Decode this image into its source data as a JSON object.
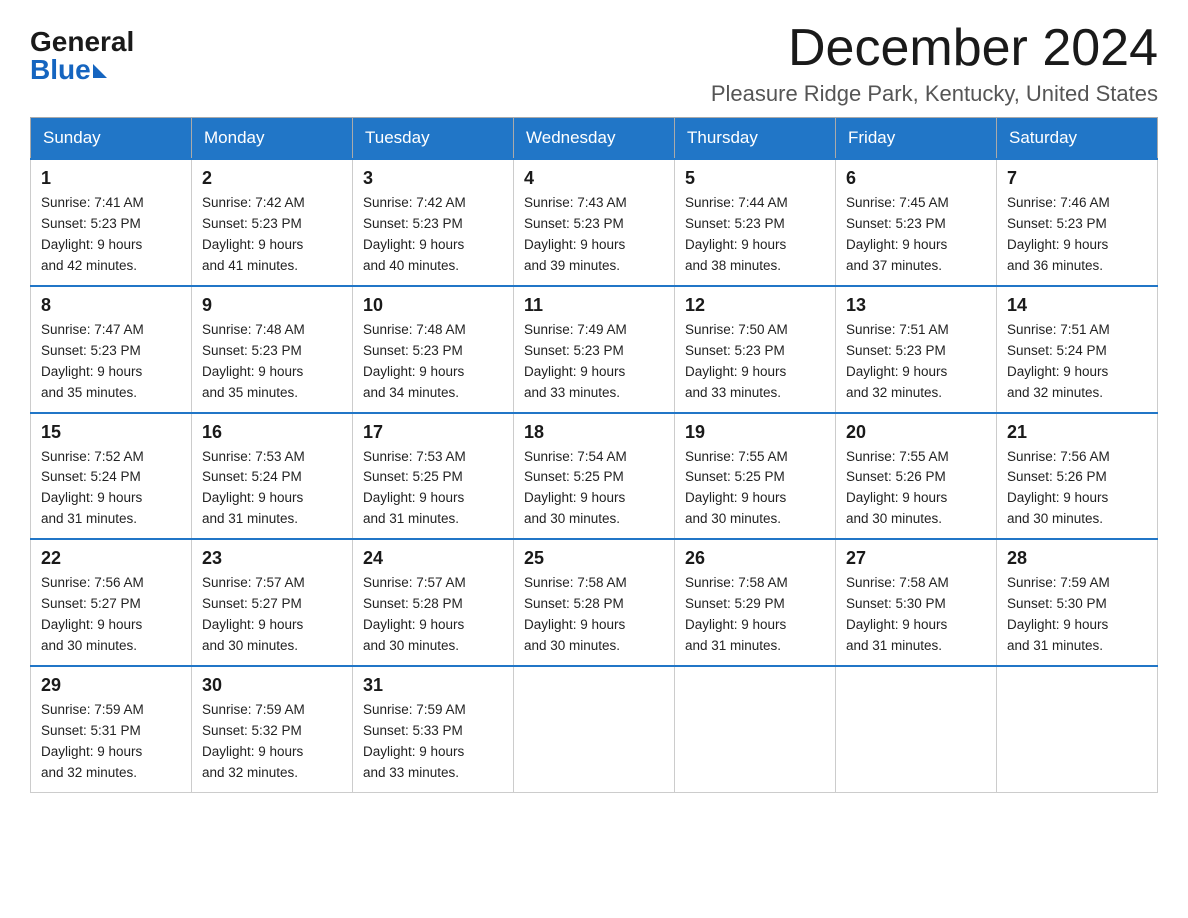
{
  "header": {
    "logo_general": "General",
    "logo_blue": "Blue",
    "month_title": "December 2024",
    "location": "Pleasure Ridge Park, Kentucky, United States"
  },
  "weekdays": [
    "Sunday",
    "Monday",
    "Tuesday",
    "Wednesday",
    "Thursday",
    "Friday",
    "Saturday"
  ],
  "weeks": [
    [
      {
        "day": "1",
        "sunrise": "7:41 AM",
        "sunset": "5:23 PM",
        "daylight": "9 hours and 42 minutes."
      },
      {
        "day": "2",
        "sunrise": "7:42 AM",
        "sunset": "5:23 PM",
        "daylight": "9 hours and 41 minutes."
      },
      {
        "day": "3",
        "sunrise": "7:42 AM",
        "sunset": "5:23 PM",
        "daylight": "9 hours and 40 minutes."
      },
      {
        "day": "4",
        "sunrise": "7:43 AM",
        "sunset": "5:23 PM",
        "daylight": "9 hours and 39 minutes."
      },
      {
        "day": "5",
        "sunrise": "7:44 AM",
        "sunset": "5:23 PM",
        "daylight": "9 hours and 38 minutes."
      },
      {
        "day": "6",
        "sunrise": "7:45 AM",
        "sunset": "5:23 PM",
        "daylight": "9 hours and 37 minutes."
      },
      {
        "day": "7",
        "sunrise": "7:46 AM",
        "sunset": "5:23 PM",
        "daylight": "9 hours and 36 minutes."
      }
    ],
    [
      {
        "day": "8",
        "sunrise": "7:47 AM",
        "sunset": "5:23 PM",
        "daylight": "9 hours and 35 minutes."
      },
      {
        "day": "9",
        "sunrise": "7:48 AM",
        "sunset": "5:23 PM",
        "daylight": "9 hours and 35 minutes."
      },
      {
        "day": "10",
        "sunrise": "7:48 AM",
        "sunset": "5:23 PM",
        "daylight": "9 hours and 34 minutes."
      },
      {
        "day": "11",
        "sunrise": "7:49 AM",
        "sunset": "5:23 PM",
        "daylight": "9 hours and 33 minutes."
      },
      {
        "day": "12",
        "sunrise": "7:50 AM",
        "sunset": "5:23 PM",
        "daylight": "9 hours and 33 minutes."
      },
      {
        "day": "13",
        "sunrise": "7:51 AM",
        "sunset": "5:23 PM",
        "daylight": "9 hours and 32 minutes."
      },
      {
        "day": "14",
        "sunrise": "7:51 AM",
        "sunset": "5:24 PM",
        "daylight": "9 hours and 32 minutes."
      }
    ],
    [
      {
        "day": "15",
        "sunrise": "7:52 AM",
        "sunset": "5:24 PM",
        "daylight": "9 hours and 31 minutes."
      },
      {
        "day": "16",
        "sunrise": "7:53 AM",
        "sunset": "5:24 PM",
        "daylight": "9 hours and 31 minutes."
      },
      {
        "day": "17",
        "sunrise": "7:53 AM",
        "sunset": "5:25 PM",
        "daylight": "9 hours and 31 minutes."
      },
      {
        "day": "18",
        "sunrise": "7:54 AM",
        "sunset": "5:25 PM",
        "daylight": "9 hours and 30 minutes."
      },
      {
        "day": "19",
        "sunrise": "7:55 AM",
        "sunset": "5:25 PM",
        "daylight": "9 hours and 30 minutes."
      },
      {
        "day": "20",
        "sunrise": "7:55 AM",
        "sunset": "5:26 PM",
        "daylight": "9 hours and 30 minutes."
      },
      {
        "day": "21",
        "sunrise": "7:56 AM",
        "sunset": "5:26 PM",
        "daylight": "9 hours and 30 minutes."
      }
    ],
    [
      {
        "day": "22",
        "sunrise": "7:56 AM",
        "sunset": "5:27 PM",
        "daylight": "9 hours and 30 minutes."
      },
      {
        "day": "23",
        "sunrise": "7:57 AM",
        "sunset": "5:27 PM",
        "daylight": "9 hours and 30 minutes."
      },
      {
        "day": "24",
        "sunrise": "7:57 AM",
        "sunset": "5:28 PM",
        "daylight": "9 hours and 30 minutes."
      },
      {
        "day": "25",
        "sunrise": "7:58 AM",
        "sunset": "5:28 PM",
        "daylight": "9 hours and 30 minutes."
      },
      {
        "day": "26",
        "sunrise": "7:58 AM",
        "sunset": "5:29 PM",
        "daylight": "9 hours and 31 minutes."
      },
      {
        "day": "27",
        "sunrise": "7:58 AM",
        "sunset": "5:30 PM",
        "daylight": "9 hours and 31 minutes."
      },
      {
        "day": "28",
        "sunrise": "7:59 AM",
        "sunset": "5:30 PM",
        "daylight": "9 hours and 31 minutes."
      }
    ],
    [
      {
        "day": "29",
        "sunrise": "7:59 AM",
        "sunset": "5:31 PM",
        "daylight": "9 hours and 32 minutes."
      },
      {
        "day": "30",
        "sunrise": "7:59 AM",
        "sunset": "5:32 PM",
        "daylight": "9 hours and 32 minutes."
      },
      {
        "day": "31",
        "sunrise": "7:59 AM",
        "sunset": "5:33 PM",
        "daylight": "9 hours and 33 minutes."
      },
      null,
      null,
      null,
      null
    ]
  ],
  "labels": {
    "sunrise": "Sunrise:",
    "sunset": "Sunset:",
    "daylight": "Daylight:"
  }
}
